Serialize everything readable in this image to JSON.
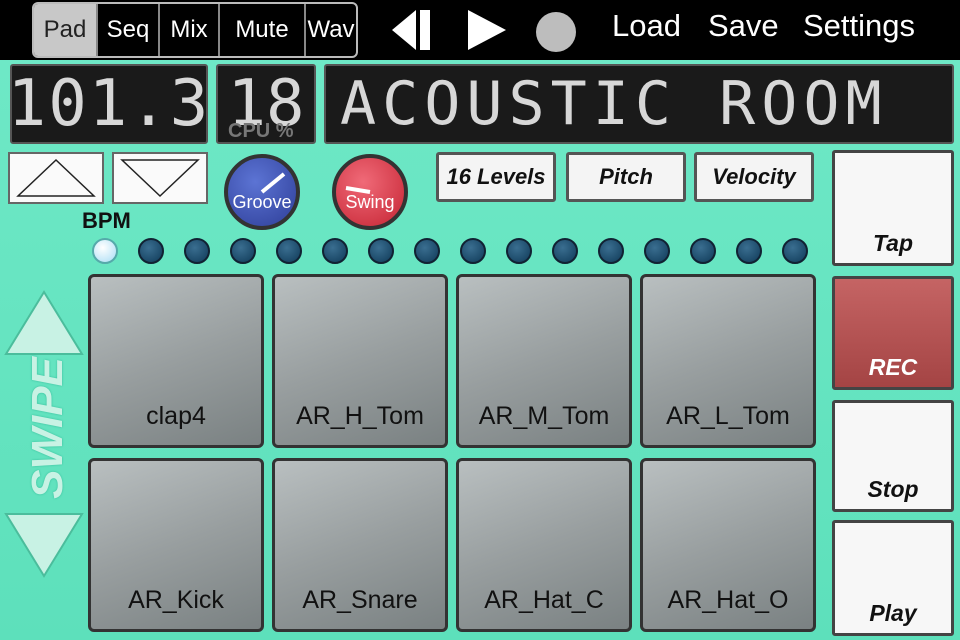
{
  "tabs": [
    {
      "label": "Pad",
      "active": true
    },
    {
      "label": "Seq",
      "active": false
    },
    {
      "label": "Mix",
      "active": false
    },
    {
      "label": "Mute",
      "active": false
    },
    {
      "label": "Wav",
      "active": false
    }
  ],
  "transport_icons": [
    "skip-back-icon",
    "play-icon",
    "record-icon"
  ],
  "menu": {
    "load": "Load",
    "save": "Save",
    "settings": "Settings"
  },
  "display": {
    "bpm": "101.3",
    "cpu": "18",
    "cpu_label": "CPU %",
    "kit_name": "ACOUSTIC ROOM"
  },
  "controls": {
    "bpm_label": "BPM",
    "groove_label": "Groove",
    "swing_label": "Swing",
    "levels_label": "16 Levels",
    "pitch_label": "Pitch",
    "velocity_label": "Velocity"
  },
  "steps": {
    "count": 16,
    "active_index": 0
  },
  "swipe_label": "SWIPE",
  "pads": [
    {
      "label": "clap4"
    },
    {
      "label": "AR_H_Tom"
    },
    {
      "label": "AR_M_Tom"
    },
    {
      "label": "AR_L_Tom"
    },
    {
      "label": "AR_Kick"
    },
    {
      "label": "AR_Snare"
    },
    {
      "label": "AR_Hat_C"
    },
    {
      "label": "AR_Hat_O"
    }
  ],
  "side_buttons": {
    "tap": "Tap",
    "rec": "REC",
    "stop": "Stop",
    "play": "Play"
  },
  "colors": {
    "panel": "#5de0bb",
    "rec": "#b35252",
    "groove_knob": "#3c50b4",
    "swing_knob": "#d83a48"
  }
}
